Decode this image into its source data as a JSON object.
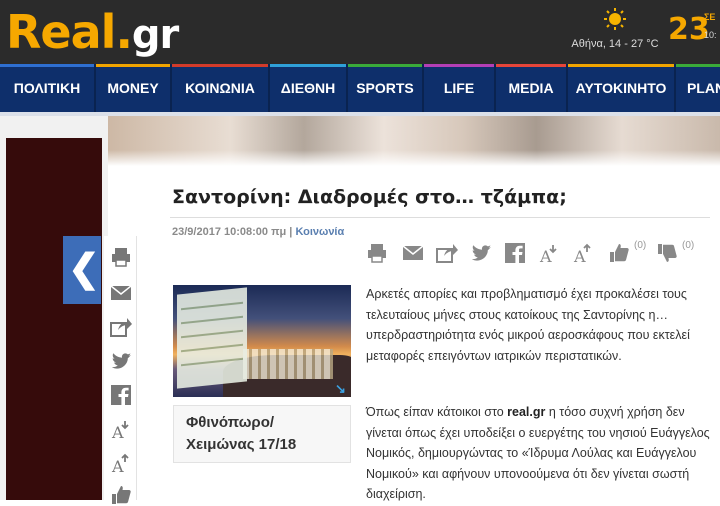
{
  "header": {
    "logo_main": "Real",
    "logo_dot": ".",
    "logo_tld": "gr",
    "weather_text": "Αθήνα, 14 - 27 °C",
    "weather_icon": "sun-icon",
    "date_day": "23",
    "date_month": "ΣΕ",
    "date_time": "10:"
  },
  "nav": {
    "items": [
      {
        "label": "ΠΟΛΙΤΙΚΗ",
        "color": "#2e6fd1"
      },
      {
        "label": "MONEY",
        "color": "#f0a400"
      },
      {
        "label": "ΚΟΙΝΩΝΙΑ",
        "color": "#d23b2b"
      },
      {
        "label": "ΔΙΕΘΝΗ",
        "color": "#2fa0d8"
      },
      {
        "label": "SPORTS",
        "color": "#3aaa3a"
      },
      {
        "label": "LIFE",
        "color": "#b33fb5"
      },
      {
        "label": "MEDIA",
        "color": "#e5453a"
      },
      {
        "label": "ΑΥΤΟΚΙΝΗΤΟ",
        "color": "#f0a400"
      },
      {
        "label": "PLAN",
        "color": "#3aaa3a"
      }
    ]
  },
  "article": {
    "title": "Σαντορίνη: Διαδρομές στο… τζάμπα;",
    "date": "23/9/2017 10:08:00 πμ",
    "separator": " | ",
    "category": "Κοινωνία",
    "like_count": "(0)",
    "dislike_count": "(0)",
    "paragraph1": "Αρκετές απορίες και προβληματισμό έχει προκαλέσει τους τελευταίους μήνες στους κατοίκους της Σαντορίνης η… υπερδραστηριότητα ενός μικρού αεροσκάφους που εκτελεί μεταφορές επειγόντων ιατρικών περιστατικών.",
    "paragraph2_pre": "Όπως είπαν κάτοικοι στο ",
    "paragraph2_source": "real.gr",
    "paragraph2_post": " η τόσο συχνή χρήση δεν γίνεται όπως έχει υποδείξει ο ευεργέτης του νησιού Ευάγγελος Νομικός, δημιουργώντας το «Ίδρυμα Λούλας και Ευάγγελου Νομικού» και αφήνουν υπονοούμενα ότι δεν γίνεται σωστή διαχείριση."
  },
  "promo": {
    "title": "Φθινόπωρο/ Χειμώνας 17/18"
  },
  "colors": {
    "nav_bg": "#0e2f6b",
    "header_bg": "#2b2b2b",
    "logo": "#f6a800",
    "back_button": "#3d6db8"
  }
}
